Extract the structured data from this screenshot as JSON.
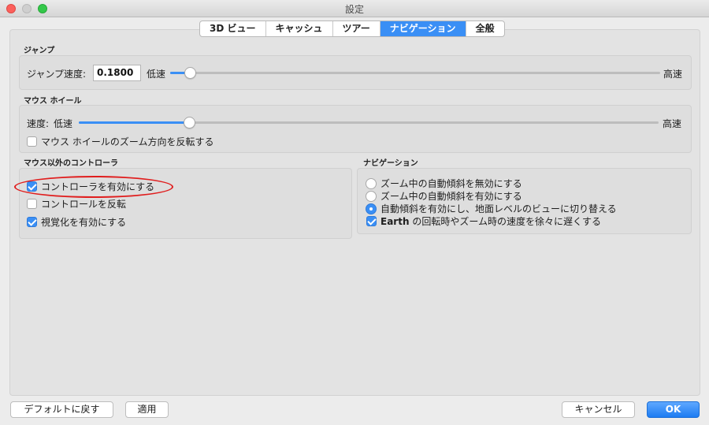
{
  "window": {
    "title": "設定"
  },
  "tabs": [
    {
      "label": "3D ビュー",
      "active": false
    },
    {
      "label": "キャッシュ",
      "active": false
    },
    {
      "label": "ツアー",
      "active": false
    },
    {
      "label": "ナビゲーション",
      "active": true
    },
    {
      "label": "全般",
      "active": false
    }
  ],
  "jump": {
    "section_title": "ジャンプ",
    "speed_label": "ジャンプ速度:",
    "speed_value": "0.1800",
    "low_label": "低速",
    "high_label": "高速",
    "slider_fraction": 0.04
  },
  "mouse_wheel": {
    "section_title": "マウス ホイール",
    "speed_label": "速度:",
    "low_label": "低速",
    "high_label": "高速",
    "slider_fraction": 0.19,
    "reverse_label": "マウス ホイールのズーム方向を反転する",
    "reverse_checked": false
  },
  "controller": {
    "section_title": "マウス以外のコントローラ",
    "enable_label": "コントローラを有効にする",
    "enable_checked": true,
    "reverse_label": "コントロールを反転",
    "reverse_checked": false,
    "visualize_label": "視覚化を有効にする",
    "visualize_checked": true
  },
  "navigation": {
    "section_title": "ナビゲーション",
    "options": [
      {
        "label": "ズーム中の自動傾斜を無効にする",
        "selected": false
      },
      {
        "label": "ズーム中の自動傾斜を有効にする",
        "selected": false
      },
      {
        "label": "自動傾斜を有効にし、地面レベルのビューに切り替える",
        "selected": true
      }
    ],
    "slow_earth_bold": "Earth",
    "slow_earth_rest": " の回転時やズーム時の速度を徐々に遅くする",
    "slow_earth_checked": true
  },
  "buttons": {
    "defaults": "デフォルトに戻す",
    "apply": "適用",
    "cancel": "キャンセル",
    "ok": "OK"
  },
  "colors": {
    "accent": "#3a8ff5",
    "highlight_circle": "#e01e1e"
  }
}
